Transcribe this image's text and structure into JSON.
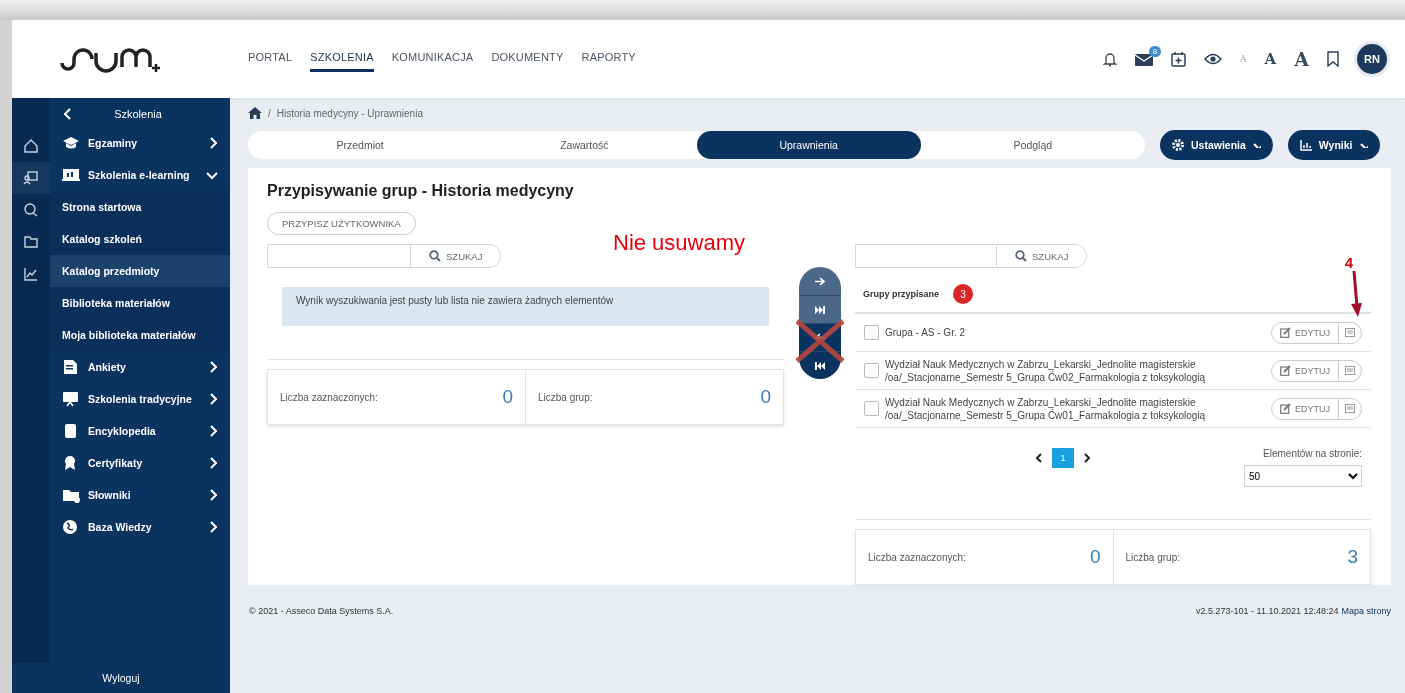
{
  "header": {
    "nav": [
      {
        "label": "PORTAL",
        "selected": false
      },
      {
        "label": "SZKOLENIA",
        "selected": true
      },
      {
        "label": "KOMUNIKACJA",
        "selected": false
      },
      {
        "label": "DOKUMENTY",
        "selected": false
      },
      {
        "label": "RAPORTY",
        "selected": false
      }
    ],
    "messages_badge": "8",
    "font_sizes": [
      {
        "label": "A",
        "kind": "small"
      },
      {
        "label": "A",
        "kind": "medium"
      },
      {
        "label": "A",
        "kind": "large"
      }
    ],
    "avatar": "RN"
  },
  "sidebar": {
    "rail": [
      {
        "selected": false
      },
      {
        "selected": true
      },
      {
        "selected": false
      },
      {
        "selected": false
      },
      {
        "selected": false
      }
    ],
    "title": "Szkolenia",
    "items": [
      {
        "label": "Egzaminy",
        "kind": "group",
        "expanded": false,
        "selected": false
      },
      {
        "label": "Szkolenia e-learning",
        "kind": "group",
        "expanded": true,
        "selected": false
      },
      {
        "label": "Strona startowa",
        "kind": "link",
        "selected": false
      },
      {
        "label": "Katalog szkoleń",
        "kind": "link",
        "selected": false
      },
      {
        "label": "Katalog przedmioty",
        "kind": "link",
        "selected": true
      },
      {
        "label": "Biblioteka materiałów",
        "kind": "link",
        "selected": false
      },
      {
        "label": "Moja biblioteka materiałów",
        "kind": "link",
        "selected": false
      },
      {
        "label": "Ankiety",
        "kind": "group",
        "expanded": false,
        "selected": false
      },
      {
        "label": "Szkolenia tradycyjne",
        "kind": "group",
        "expanded": false,
        "selected": false
      },
      {
        "label": "Encyklopedia",
        "kind": "group",
        "expanded": false,
        "selected": false
      },
      {
        "label": "Certyfikaty",
        "kind": "group",
        "expanded": false,
        "selected": false
      },
      {
        "label": "Słowniki",
        "kind": "group",
        "expanded": false,
        "selected": false
      },
      {
        "label": "Baza Wiedzy",
        "kind": "group",
        "expanded": false,
        "selected": false
      }
    ],
    "logout": "Wyloguj"
  },
  "breadcrumb": {
    "separator": "/",
    "text": "Historia medycyny - Uprawnienia"
  },
  "tabs": [
    {
      "label": "Przedmiot",
      "selected": false
    },
    {
      "label": "Zawartość",
      "selected": false
    },
    {
      "label": "Uprawnienia",
      "selected": true
    },
    {
      "label": "Podgląd",
      "selected": false
    }
  ],
  "actions": [
    "Ustawienia",
    "Wyniki"
  ],
  "card": {
    "title": "Przypisywanie grup - Historia medycyny",
    "assign_button": "PRZYPISZ UŻYTKOWNIKA",
    "left": {
      "search_button": "SZUKAJ",
      "empty_message": "Wynik wyszukiwania jest pusty lub lista nie zawiera żadnych elementów",
      "selected_label": "Liczba zaznaczonych:",
      "selected_count": "0",
      "groups_label": "Liczba grup:",
      "groups_count": "0"
    },
    "annotation": "Nie usuwamy",
    "annotation_number": "4",
    "right": {
      "search_button": "SZUKAJ",
      "list_title": "Grupy przypisane",
      "list_count": "3",
      "rows": [
        {
          "lines": [
            "Grupa - AS - Gr. 2"
          ],
          "checked": false,
          "edit": "EDYTUJ"
        },
        {
          "lines": [
            "Wydział Nauk Medycznych w Zabrzu_Lekarski_Jednolite magisterskie",
            "/oa/_Stacjonarne_Semestr 5_Grupa Ćw02_Farmakologia z toksykologią"
          ],
          "checked": false,
          "edit": "EDYTUJ"
        },
        {
          "lines": [
            "Wydział Nauk Medycznych w Zabrzu_Lekarski_Jednolite magisterskie",
            "/oa/_Stacjonarne_Semestr 5_Grupa Ćw01_Farmakologia z toksykologią"
          ],
          "checked": false,
          "edit": "EDYTUJ"
        }
      ],
      "pages": [
        {
          "label": "1",
          "selected": true
        }
      ],
      "per_page_label": "Elementów na stronie:",
      "per_page": "50",
      "selected_label": "Liczba zaznaczonych:",
      "selected_count": "0",
      "groups_label": "Liczba grup:",
      "groups_count": "3"
    }
  },
  "footer": {
    "copyright": "© 2021 - Asseco Data Systems S.A.",
    "version": "v2.5.273-101 - 11.10.2021 12:48:24",
    "sitemap": "Mapa strony"
  }
}
